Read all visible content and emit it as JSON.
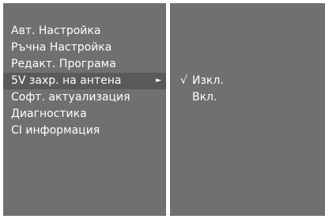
{
  "menu": {
    "items": [
      {
        "label": "Авт. Настройка"
      },
      {
        "label": "Ръчна Настройка"
      },
      {
        "label": "Редакт. Програма"
      },
      {
        "label": "5V захр. на антена",
        "arrow": "►"
      },
      {
        "label": "Софт. актуализация"
      },
      {
        "label": "Диагностика"
      },
      {
        "label": "CI информация"
      }
    ]
  },
  "submenu": {
    "items": [
      {
        "label": "Изкл.",
        "check": "√"
      },
      {
        "label": "Вкл.",
        "check": ""
      }
    ]
  },
  "colors": {
    "panel": "#707070",
    "highlight": "#5a5a5a",
    "text": "#ffffff",
    "divider": "#ffffff"
  }
}
